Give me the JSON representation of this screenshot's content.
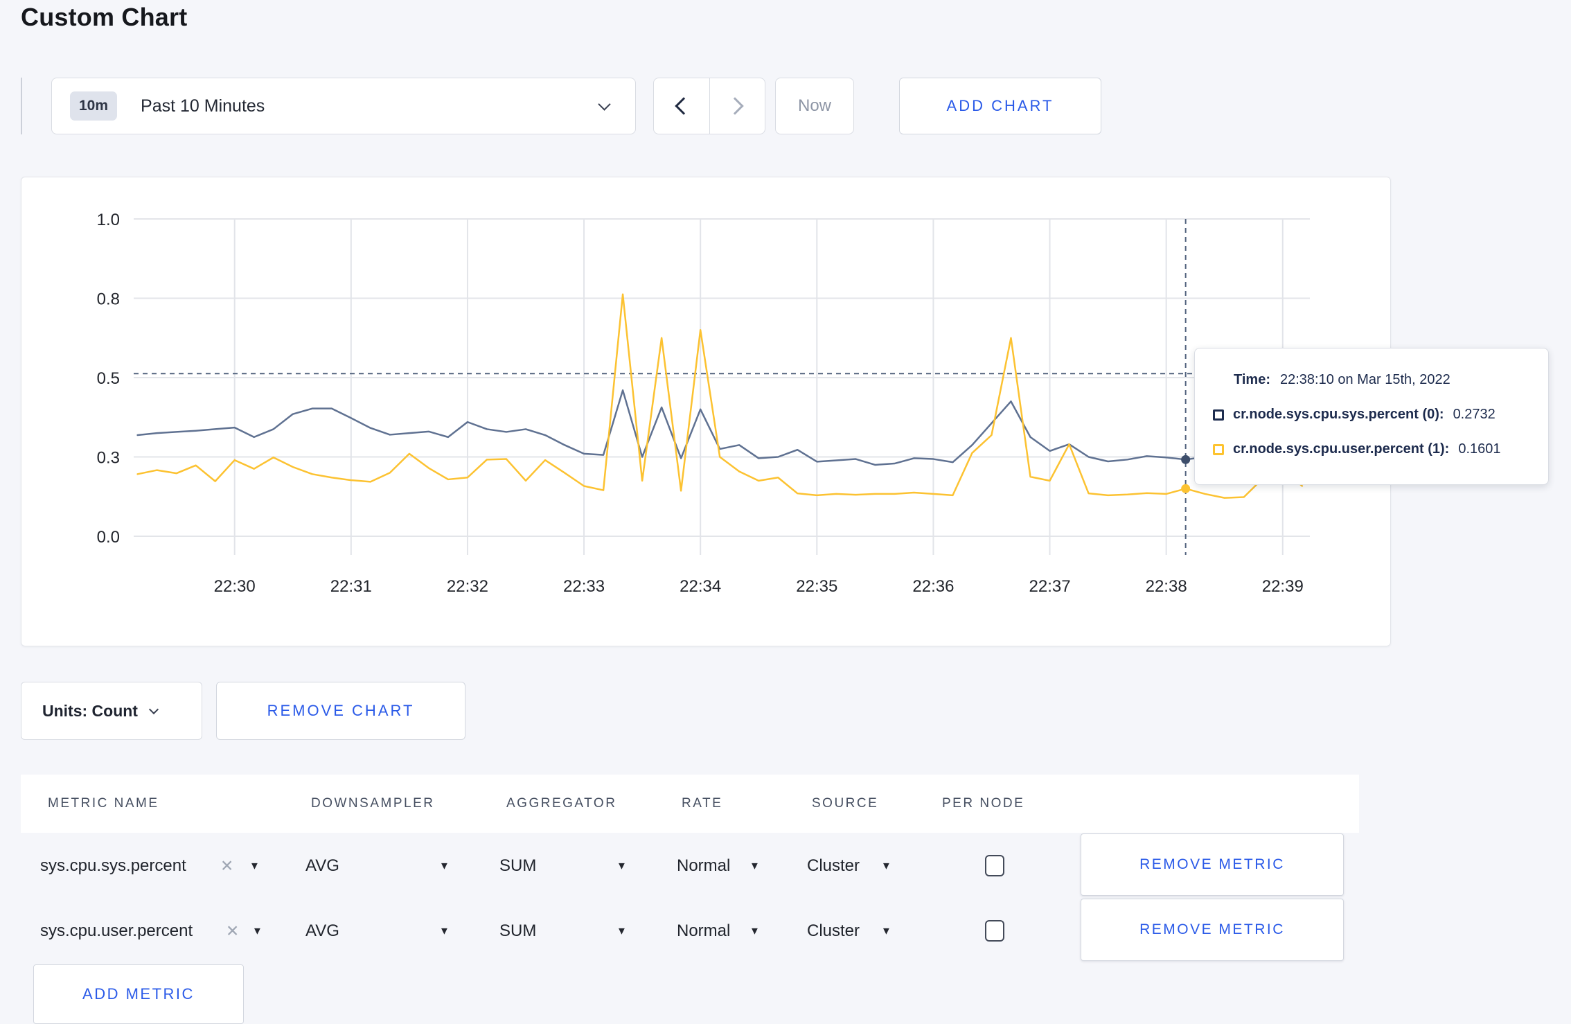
{
  "page": {
    "title": "Custom Chart",
    "background": "#f5f6fa",
    "accent_blue": "#2a5ae8"
  },
  "toolbar": {
    "time_window_badge": "10m",
    "time_window_label": "Past 10 Minutes",
    "now_label": "Now",
    "add_chart_label": "ADD CHART"
  },
  "chart": {
    "tooltip": {
      "time_label": "Time:",
      "time_value": "22:38:10 on Mar 15th, 2022",
      "series": [
        {
          "name": "cr.node.sys.cpu.sys.percent (0):",
          "value": "0.2732",
          "color": "#1d2c4e"
        },
        {
          "name": "cr.node.sys.cpu.user.percent (1):",
          "value": "0.1601",
          "color": "#fdc32f"
        }
      ]
    }
  },
  "chart_data": {
    "type": "line",
    "title": "",
    "xlabel": "",
    "ylabel": "",
    "grid": true,
    "legend_position": "none",
    "y_ticks": [
      "1.0",
      "0.8",
      "0.5",
      "0.3",
      "0.0"
    ],
    "x_ticks": [
      "22:30",
      "22:31",
      "22:32",
      "22:33",
      "22:34",
      "22:35",
      "22:36",
      "22:37",
      "22:38",
      "22:39"
    ],
    "start_time": "22:29:10",
    "interval_seconds": 10,
    "crosshair": {
      "index": 54,
      "time": "22:38:10",
      "h_value": 0.515
    },
    "series": [
      {
        "name": "cr.node.sys.cpu.sys.percent (0)",
        "color": "#5f7191",
        "dot_color": "#3e4e6b",
        "values": [
          0.355,
          0.36,
          0.363,
          0.366,
          0.37,
          0.374,
          0.35,
          0.37,
          0.408,
          0.422,
          0.422,
          0.398,
          0.373,
          0.356,
          0.36,
          0.364,
          0.35,
          0.388,
          0.37,
          0.363,
          0.37,
          0.355,
          0.33,
          0.308,
          0.305,
          0.468,
          0.3,
          0.425,
          0.295,
          0.42,
          0.32,
          0.33,
          0.295,
          0.3,
          0.318,
          0.282,
          0.287,
          0.292,
          0.27,
          0.275,
          0.295,
          0.292,
          0.28,
          0.33,
          0.385,
          0.44,
          0.35,
          0.315,
          0.332,
          0.3,
          0.283,
          0.29,
          0.302,
          0.298,
          0.29,
          0.3,
          0.298,
          0.3,
          0.3,
          0.302,
          0.3
        ]
      },
      {
        "name": "cr.node.sys.cpu.user.percent (1)",
        "color": "#fcc231",
        "dot_color": "#fcc231",
        "values": [
          0.235,
          0.25,
          0.238,
          0.268,
          0.208,
          0.288,
          0.255,
          0.298,
          0.262,
          0.235,
          0.222,
          0.212,
          0.206,
          0.24,
          0.308,
          0.258,
          0.215,
          0.222,
          0.29,
          0.292,
          0.21,
          0.288,
          0.24,
          0.19,
          0.174,
          0.81,
          0.21,
          0.65,
          0.172,
          0.68,
          0.3,
          0.245,
          0.21,
          0.222,
          0.162,
          0.155,
          0.16,
          0.157,
          0.16,
          0.16,
          0.165,
          0.16,
          0.155,
          0.31,
          0.355,
          0.65,
          0.225,
          0.21,
          0.332,
          0.162,
          0.155,
          0.158,
          0.163,
          0.16,
          0.18,
          0.16,
          0.145,
          0.148,
          0.22,
          0.255,
          0.19
        ]
      }
    ]
  },
  "units_bar": {
    "units_label": "Units: Count",
    "remove_chart_label": "REMOVE CHART"
  },
  "metrics_table": {
    "columns": [
      "METRIC NAME",
      "DOWNSAMPLER",
      "AGGREGATOR",
      "RATE",
      "SOURCE",
      "PER NODE"
    ],
    "rows": [
      {
        "metric": "sys.cpu.sys.percent",
        "downsampler": "AVG",
        "aggregator": "SUM",
        "rate": "Normal",
        "source": "Cluster",
        "per_node_checked": false,
        "remove_label": "REMOVE METRIC"
      },
      {
        "metric": "sys.cpu.user.percent",
        "downsampler": "AVG",
        "aggregator": "SUM",
        "rate": "Normal",
        "source": "Cluster",
        "per_node_checked": false,
        "remove_label": "REMOVE METRIC"
      }
    ],
    "add_metric_label": "ADD METRIC"
  }
}
